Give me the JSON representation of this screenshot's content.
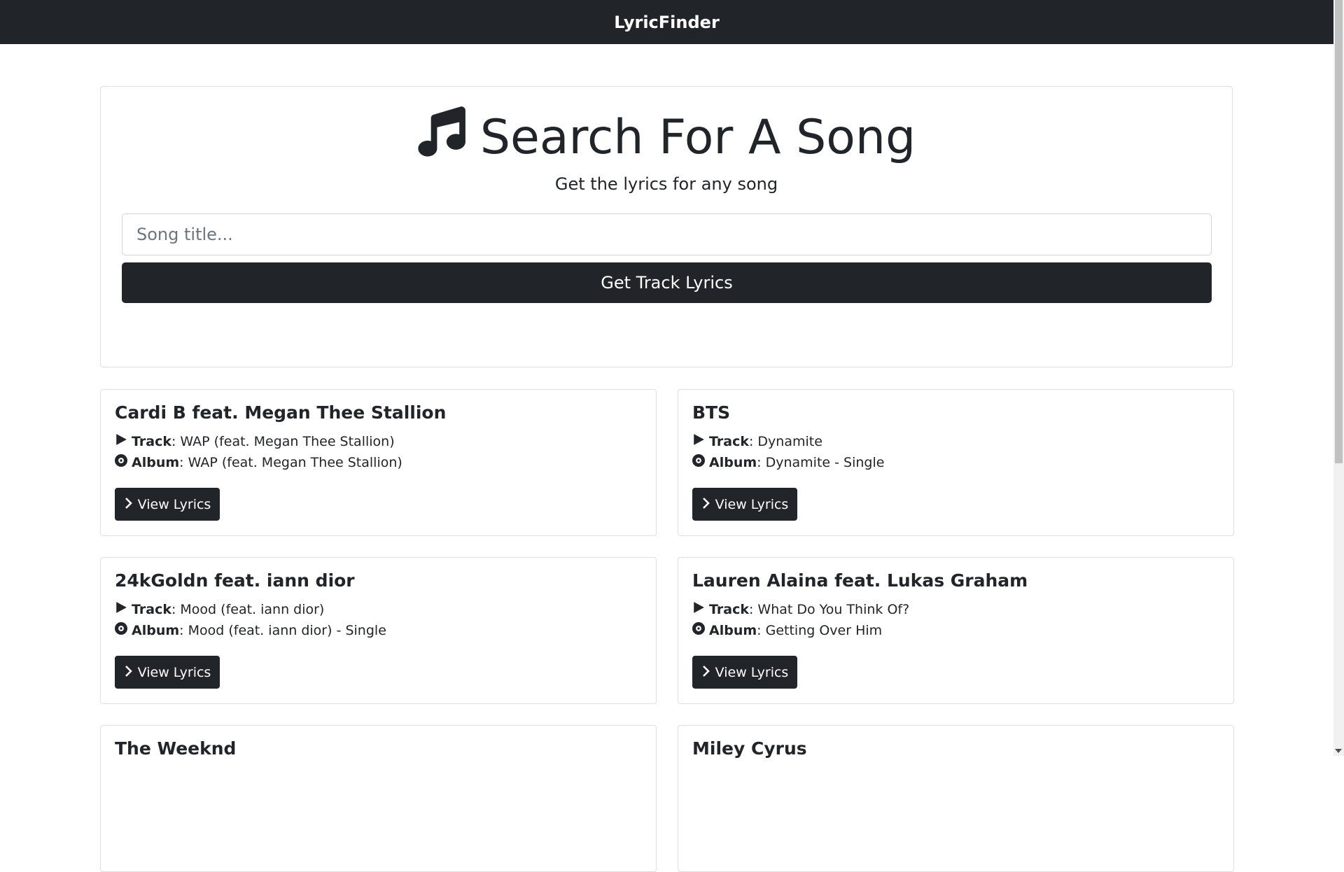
{
  "navbar": {
    "brand": "LyricFinder"
  },
  "search": {
    "title": "Search For A Song",
    "subtitle": "Get the lyrics for any song",
    "placeholder": "Song title...",
    "value": "",
    "button_label": "Get Track Lyrics"
  },
  "labels": {
    "track": "Track",
    "album": "Album",
    "view_lyrics": "View Lyrics"
  },
  "results": [
    {
      "artist": "Cardi B feat. Megan Thee Stallion",
      "track": ": WAP (feat. Megan Thee Stallion)",
      "album": ": WAP (feat. Megan Thee Stallion)"
    },
    {
      "artist": "BTS",
      "track": ": Dynamite",
      "album": ": Dynamite - Single"
    },
    {
      "artist": "24kGoldn feat. iann dior",
      "track": ": Mood (feat. iann dior)",
      "album": ": Mood (feat. iann dior) - Single"
    },
    {
      "artist": "Lauren Alaina feat. Lukas Graham",
      "track": ": What Do You Think Of?",
      "album": ": Getting Over Him"
    },
    {
      "artist": "The Weeknd"
    },
    {
      "artist": "Miley Cyrus"
    }
  ],
  "colors": {
    "navbar_bg": "#212529",
    "button_bg": "#212529",
    "text": "#212529",
    "card_border": "#dfdfdf"
  }
}
